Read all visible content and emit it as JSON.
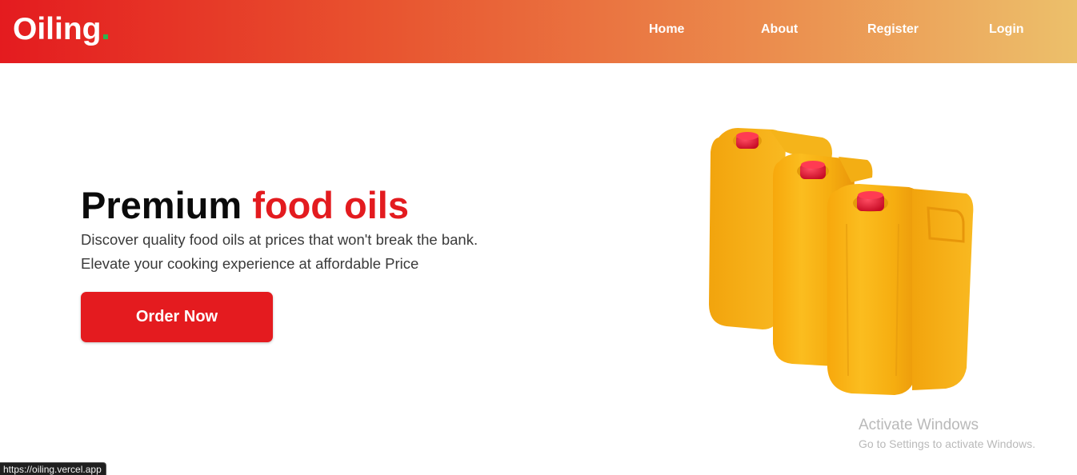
{
  "brand": {
    "name": "Oiling",
    "dot_color": "#2fb24c",
    "header_gradient": [
      "#e41b1f",
      "#ecc06b"
    ]
  },
  "nav": {
    "items": [
      {
        "label": "Home"
      },
      {
        "label": "About"
      },
      {
        "label": "Register"
      },
      {
        "label": "Login"
      }
    ]
  },
  "hero": {
    "title_main": "Premium",
    "title_accent": "food oils",
    "accent_color": "#e31b1f",
    "subtitle_line1": "Discover quality food oils at prices that won't break the bank.",
    "subtitle_line2": "Elevate your cooking experience at affordable Price",
    "cta_label": "Order Now",
    "image": "yellow-oil-jerrycans-image"
  },
  "watermark": {
    "title": "Activate Windows",
    "subtitle": "Go to Settings to activate Windows."
  },
  "status_bar": {
    "url": "https://oiling.vercel.app"
  }
}
